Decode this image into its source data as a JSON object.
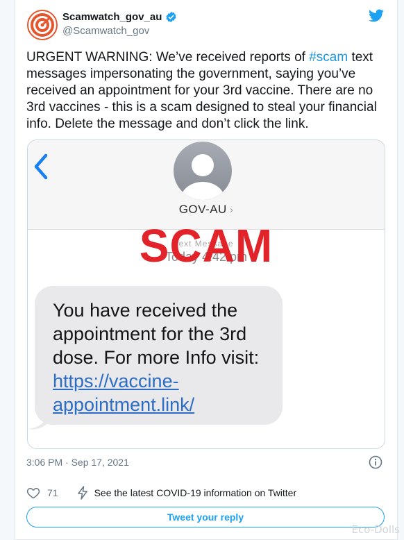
{
  "tweet": {
    "display_name": "Scamwatch_gov_au",
    "handle": "@Scamwatch_gov",
    "text_before": "URGENT WARNING: We’ve received reports of ",
    "hashtag": "#scam",
    "text_after": " text messages impersonating the government, saying you’ve received an appointment for your 3rd vaccine. There are no 3rd vaccines - this is a scam designed to steal your financial info. Delete the message and don’t click the link.",
    "timestamp": "3:06 PM · Sep 17, 2021",
    "like_count": "71",
    "covid_info": "See the latest COVID-19 information on Twitter",
    "reply_button": "Tweet your reply"
  },
  "media": {
    "contact_name": "GOV-AU",
    "contact_chevron": "›",
    "faded_line": "ext Message",
    "message_time": "Today 4:42 pm",
    "stamp": "SCAM",
    "bubble_text": "You have received the appointment for the 3rd dose. For more Info visit:",
    "bubble_link": "https://vaccine-appointment.link/"
  },
  "watermark": "Eco-Dolls",
  "colors": {
    "twitter_blue": "#1da1f2",
    "hashtag_blue": "#1b95e0",
    "scam_red": "#e2232a",
    "bubble_gray": "#e9e9eb",
    "verified_blue": "#1da1f2",
    "brand_orange": "#e4572e"
  },
  "icons": {
    "avatar": "scamwatch-target-logo",
    "verified": "verified-badge-icon",
    "twitter": "twitter-bird-icon",
    "back": "chevron-left-icon",
    "contact": "person-avatar-icon",
    "info": "info-icon",
    "like": "heart-icon",
    "covid": "lightning-bolt-icon"
  }
}
